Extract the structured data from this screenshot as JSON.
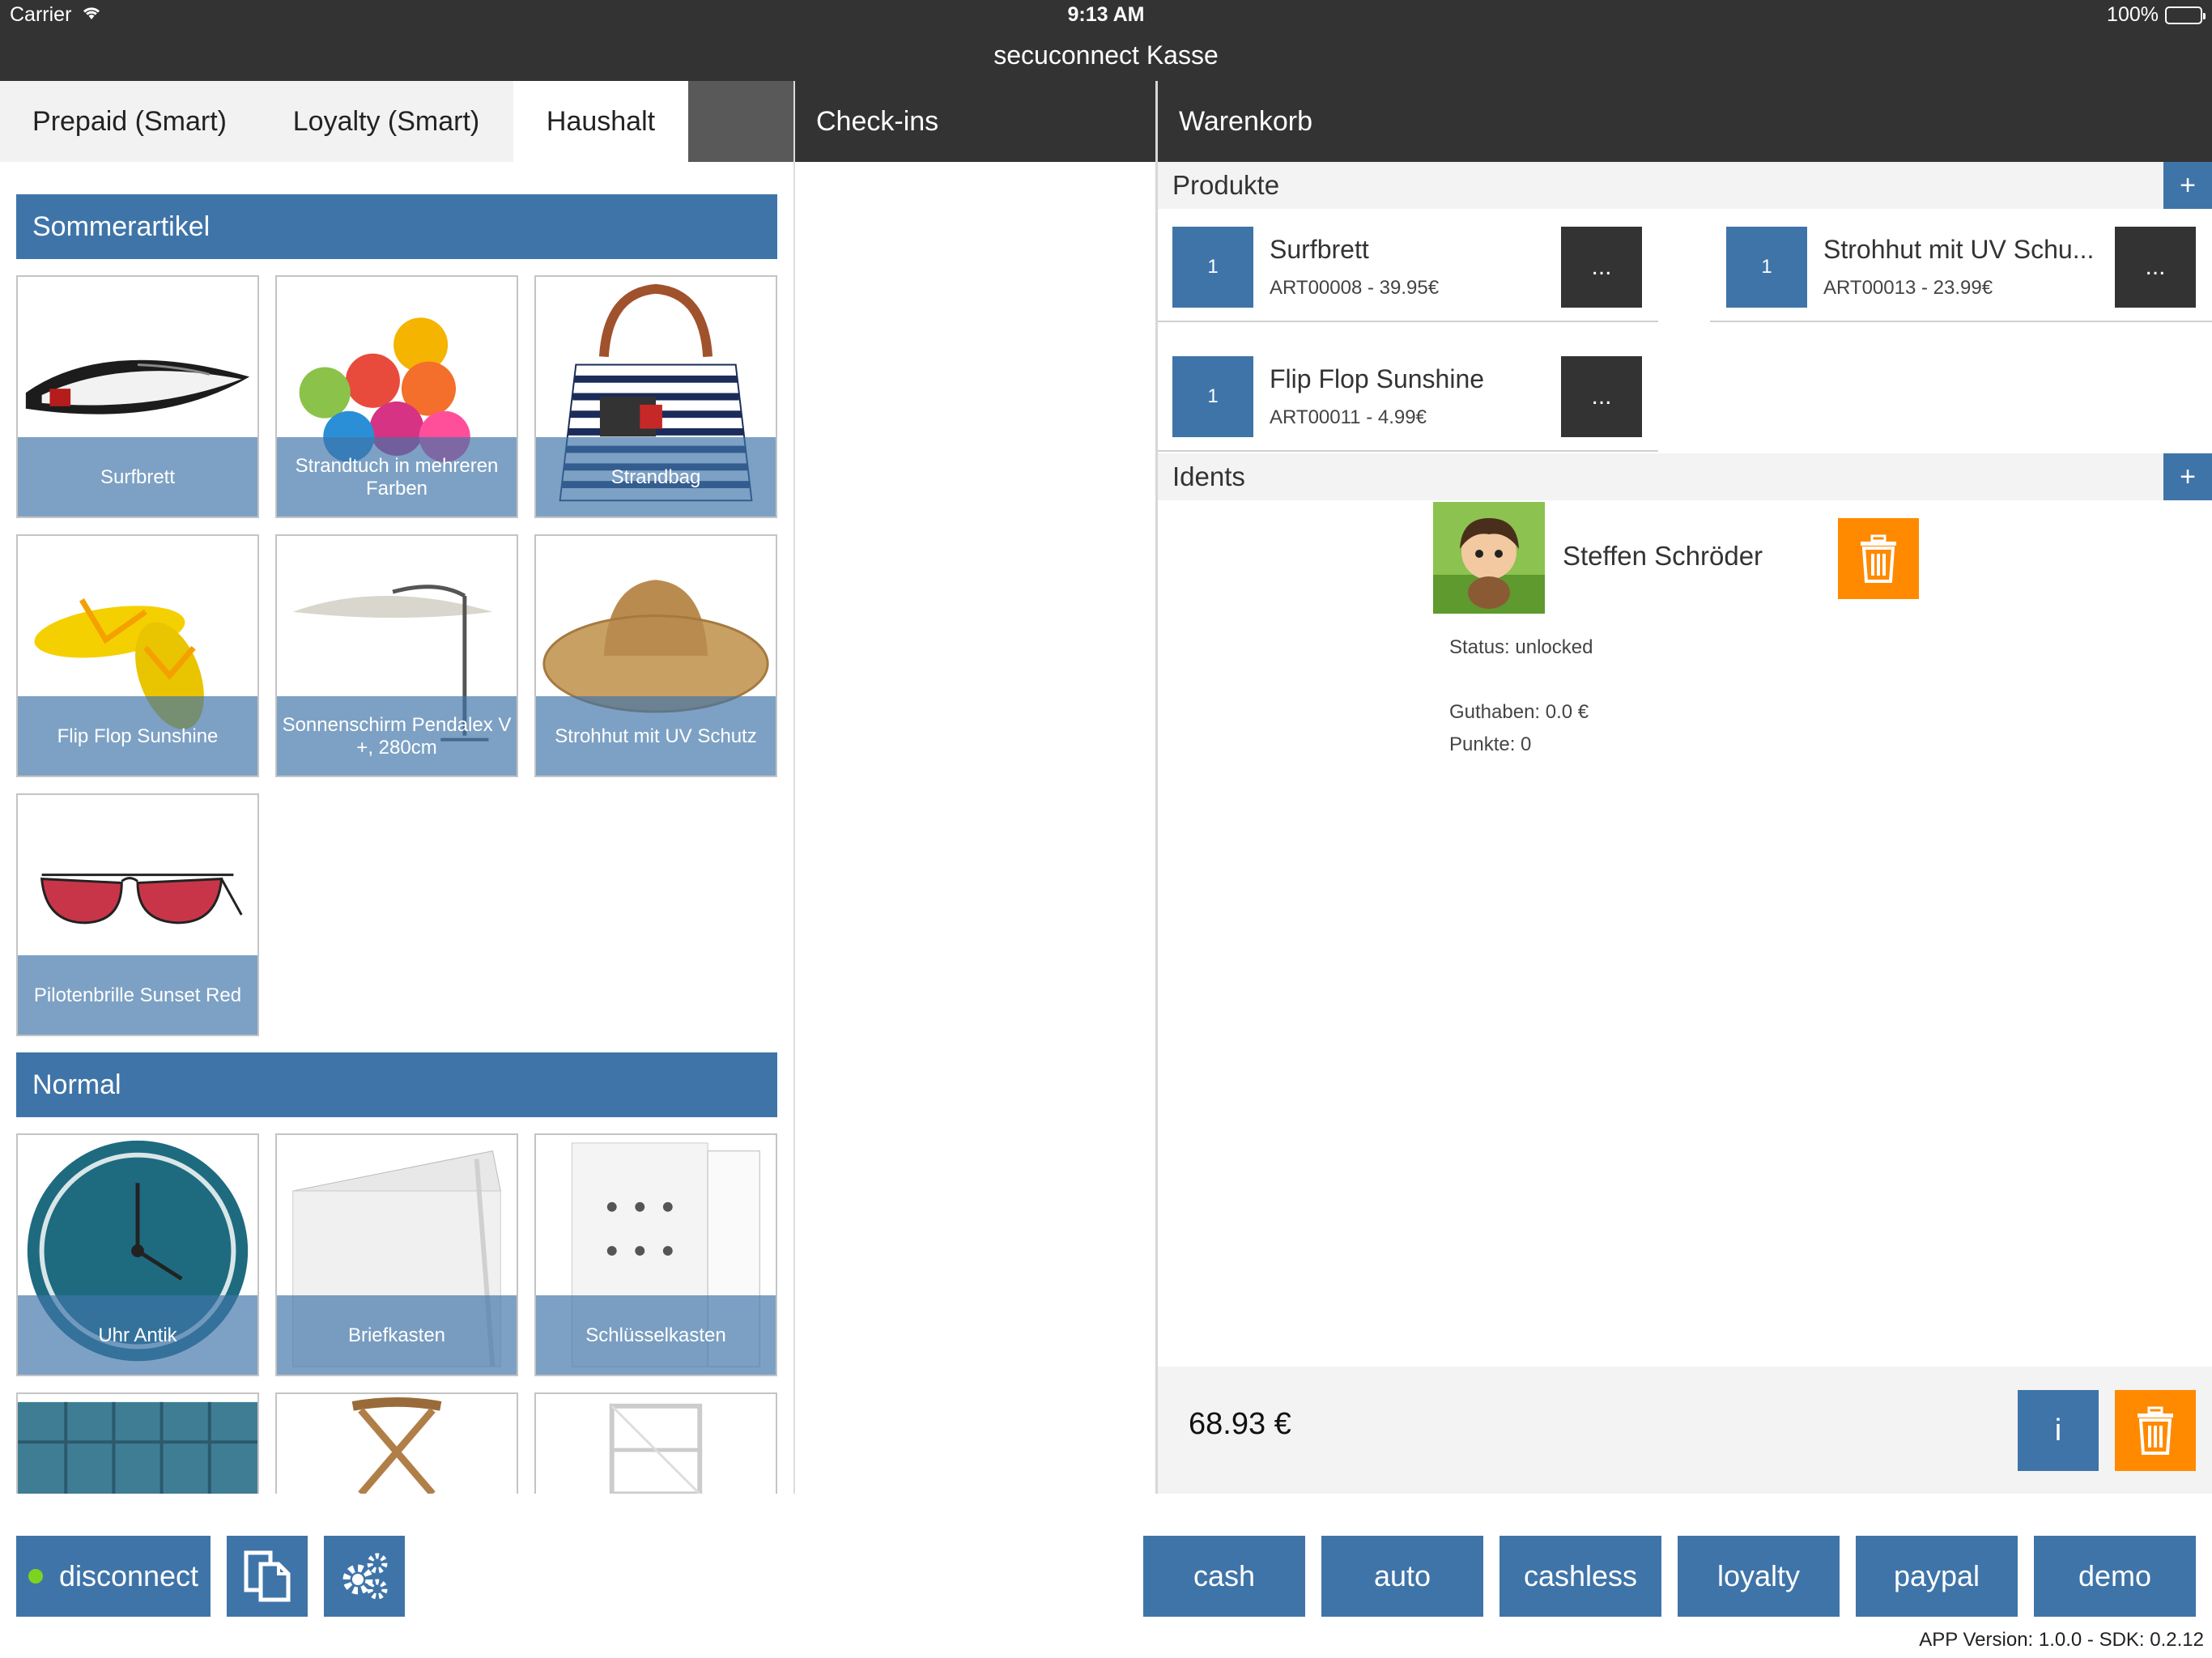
{
  "status_bar": {
    "carrier": "Carrier",
    "time": "9:13 AM",
    "battery": "100%"
  },
  "app_title": "secuconnect Kasse",
  "tabs": [
    {
      "label": "Prepaid (Smart)",
      "active": false
    },
    {
      "label": "Loyalty (Smart)",
      "active": false
    },
    {
      "label": "Haushalt",
      "active": true
    }
  ],
  "checkins": {
    "title": "Check-ins"
  },
  "products_pane": {
    "sections": [
      {
        "title": "Sommerartikel",
        "items": [
          {
            "label": "Surfbrett"
          },
          {
            "label": "Strandtuch in mehreren Farben"
          },
          {
            "label": "Strandbag"
          },
          {
            "label": "Flip Flop Sunshine"
          },
          {
            "label": "Sonnenschirm Pendalex V +, 280cm"
          },
          {
            "label": "Strohhut mit UV Schutz"
          },
          {
            "label": "Pilotenbrille Sunset Red"
          }
        ]
      },
      {
        "title": "Normal",
        "items": [
          {
            "label": "Uhr Antik"
          },
          {
            "label": "Briefkasten"
          },
          {
            "label": "Schlüsselkasten"
          },
          {
            "label": ""
          },
          {
            "label": ""
          },
          {
            "label": ""
          }
        ]
      }
    ]
  },
  "cart": {
    "title": "Warenkorb",
    "products_header": "Produkte",
    "add_label": "+",
    "more_label": "...",
    "products": [
      {
        "qty": "1",
        "name": "Surfbrett",
        "sub": "ART00008 - 39.95€"
      },
      {
        "qty": "1",
        "name": "Strohhut mit UV Schu...",
        "sub": "ART00013 - 23.99€"
      },
      {
        "qty": "1",
        "name": "Flip Flop Sunshine",
        "sub": "ART00011 - 4.99€"
      }
    ],
    "idents_header": "Idents",
    "ident": {
      "name": "Steffen Schröder",
      "status": "Status: unlocked",
      "balance": "Guthaben: 0.0 €",
      "points": "Punkte: 0"
    },
    "total": "68.93 €",
    "info_label": "i"
  },
  "bottom_bar": {
    "disconnect_label": "disconnect",
    "connection_color": "#7ed321",
    "payment_buttons": [
      "cash",
      "auto",
      "cashless",
      "loyalty",
      "paypal",
      "demo"
    ]
  },
  "version": "APP Version: 1.0.0 - SDK: 0.2.12",
  "colors": {
    "accent": "#3f74a8",
    "dark": "#333333",
    "delete": "#ff8a00"
  }
}
